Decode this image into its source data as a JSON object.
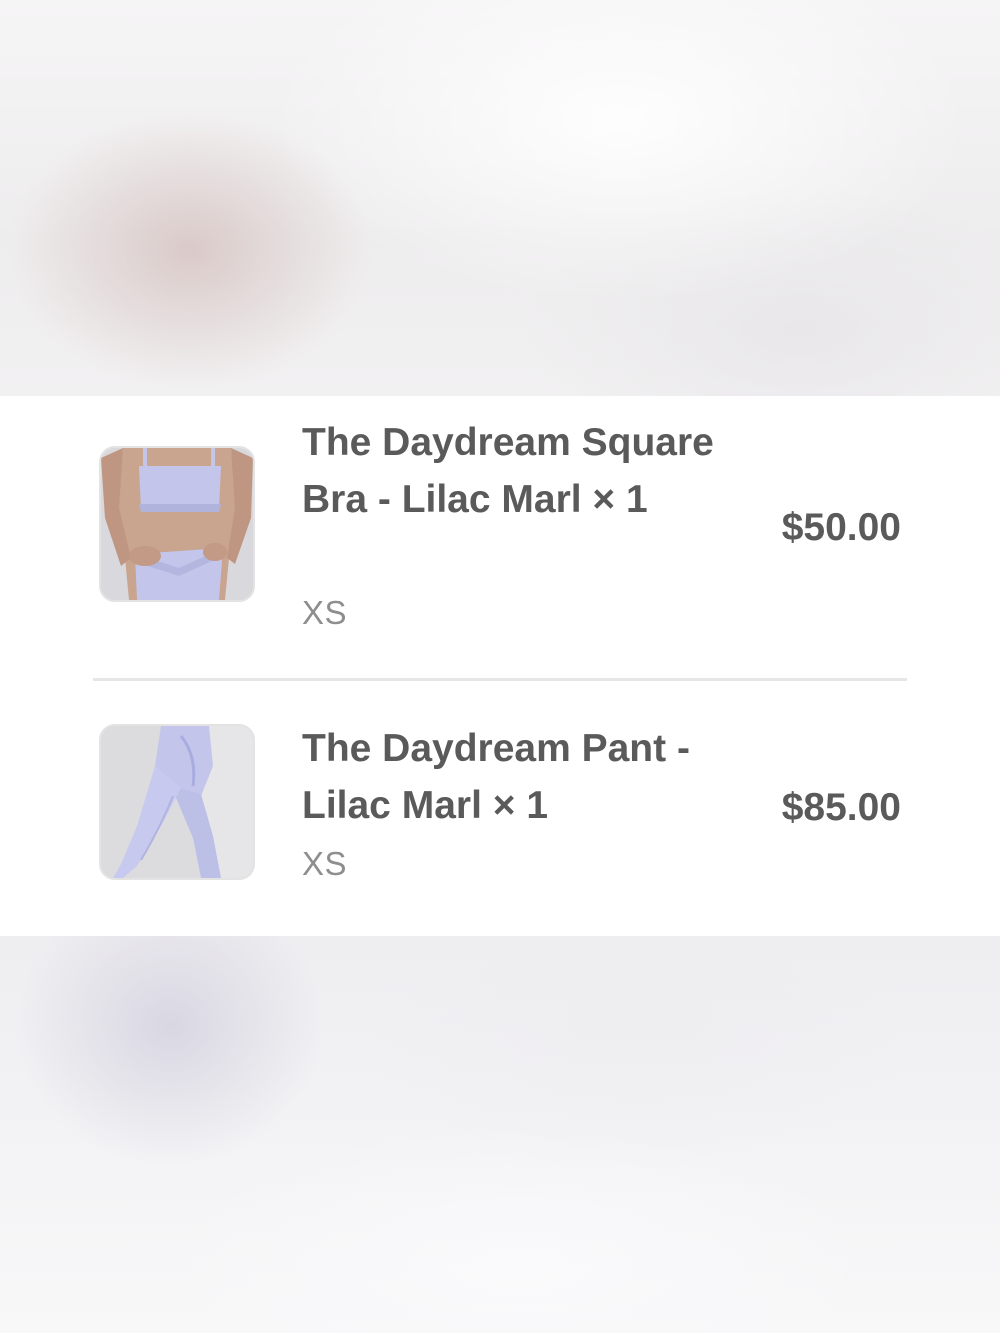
{
  "order_items": [
    {
      "title": "The Daydream Square Bra - Lilac Marl × 1",
      "variant": "XS",
      "price": "$50.00",
      "thumbnail_icon": "sports-bra-photo"
    },
    {
      "title": "The Daydream Pant - Lilac Marl × 1",
      "variant": "XS",
      "price": "$85.00",
      "thumbnail_icon": "leggings-photo"
    }
  ],
  "colors": {
    "text_primary": "#5a5a5a",
    "text_secondary": "#8e8e8e",
    "product_lilac": "#c3c6ea",
    "divider": "#e6e6e6"
  }
}
